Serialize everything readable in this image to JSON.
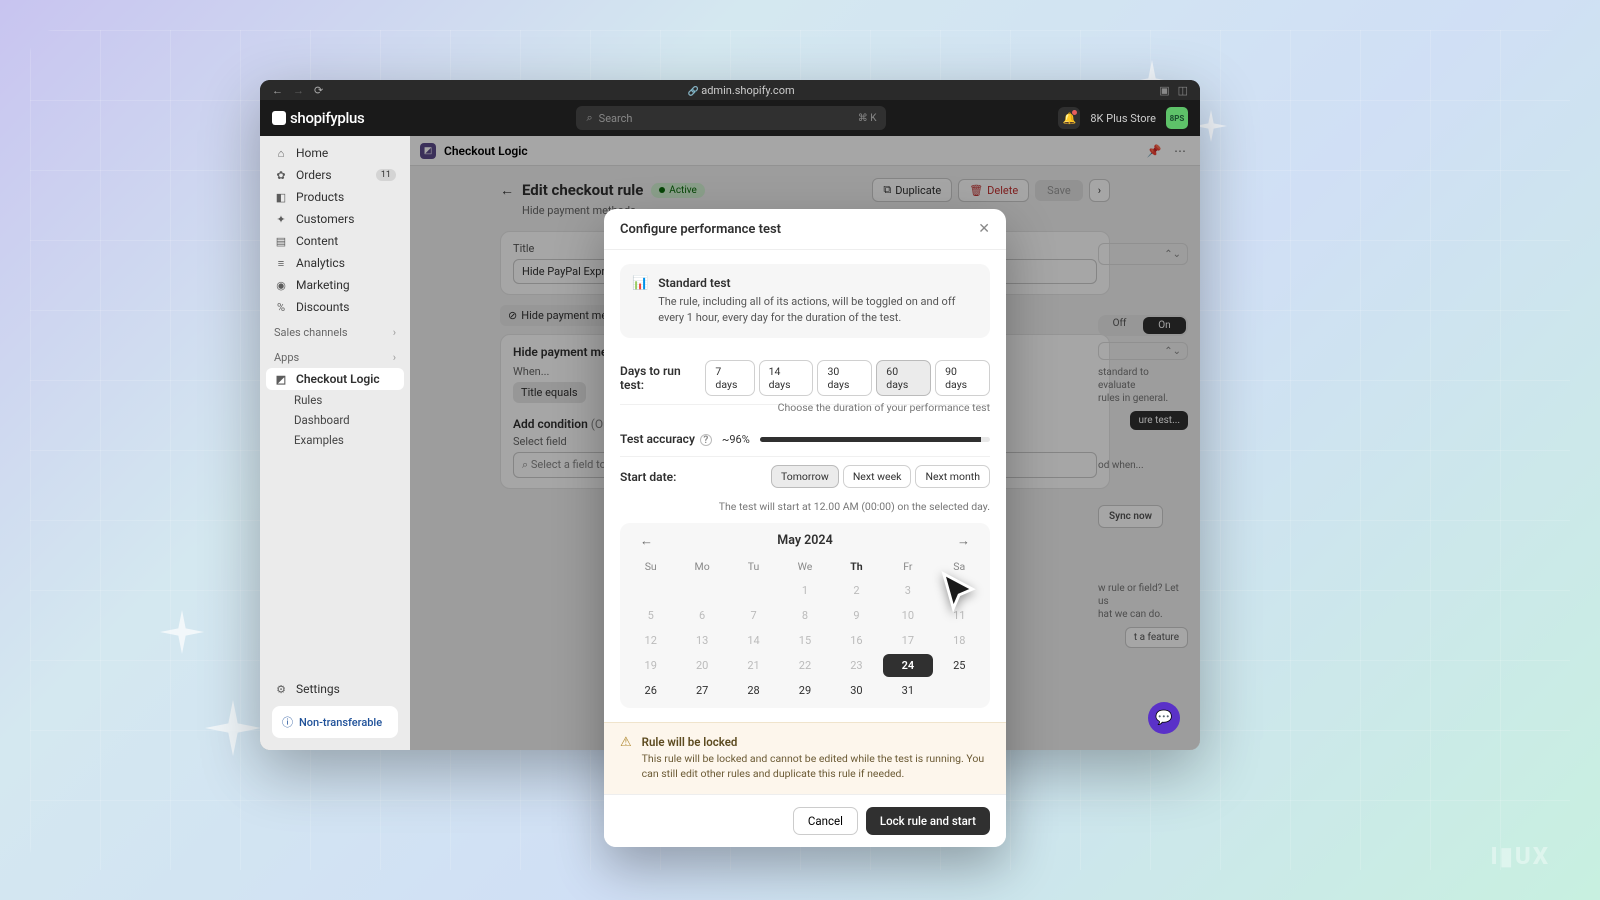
{
  "browser": {
    "url": "admin.shopify.com"
  },
  "topbar": {
    "logo": "shopifyplus",
    "search_placeholder": "Search",
    "search_kbd": "⌘ K",
    "store_name": "8K Plus Store",
    "avatar_initials": "8PS"
  },
  "sidebar": {
    "items": [
      {
        "icon": "⌂",
        "label": "Home"
      },
      {
        "icon": "✿",
        "label": "Orders",
        "badge": "11"
      },
      {
        "icon": "◧",
        "label": "Products"
      },
      {
        "icon": "✦",
        "label": "Customers"
      },
      {
        "icon": "▤",
        "label": "Content"
      },
      {
        "icon": "≡",
        "label": "Analytics"
      },
      {
        "icon": "◉",
        "label": "Marketing"
      },
      {
        "icon": "%",
        "label": "Discounts"
      }
    ],
    "section_channels": "Sales channels",
    "section_apps": "Apps",
    "app": {
      "label": "Checkout Logic",
      "subs": [
        "Rules",
        "Dashboard",
        "Examples"
      ]
    },
    "settings": "Settings",
    "non_transferable": "Non-transferable"
  },
  "page": {
    "app_name": "Checkout Logic",
    "title": "Edit checkout rule",
    "status": "Active",
    "subtitle": "Hide payment methods",
    "actions": {
      "duplicate": "Duplicate",
      "delete": "Delete",
      "save": "Save"
    },
    "card_title_label": "Title",
    "title_value": "Hide PayPal Express C",
    "chip": "Hide payment method",
    "section_hide": "Hide payment method",
    "when": "When...",
    "title_equals": "Title equals",
    "add_condition": "Add condition",
    "optional": "(Optional",
    "select_field": "Select field",
    "select_placeholder": "Select a field to ad",
    "side_off": "Off",
    "side_on": "On",
    "side_hint1": "standard to evaluate",
    "side_hint2": "rules in general.",
    "configure_btn": "ure test...",
    "side_hint3": "od when...",
    "sync": "Sync now",
    "side_hint4": "w rule or field? Let us",
    "side_hint5": "hat we can do.",
    "feature_btn": "t a feature"
  },
  "modal": {
    "title": "Configure performance test",
    "standard_title": "Standard test",
    "standard_desc": "The rule, including all of its actions, will be toggled on and off every 1 hour, every day for the duration of the test.",
    "days_label": "Days to run test:",
    "days_options": [
      "7 days",
      "14 days",
      "30 days",
      "60 days",
      "90 days"
    ],
    "days_selected": "60 days",
    "days_help": "Choose the duration of your performance test",
    "accuracy_label": "Test accuracy",
    "accuracy_value": "~96%",
    "accuracy_pct": 96,
    "start_label": "Start date:",
    "start_options": [
      "Tomorrow",
      "Next week",
      "Next month"
    ],
    "start_selected": "Tomorrow",
    "start_help": "The test will start at 12.00 AM (00:00) on the selected day.",
    "calendar": {
      "month": "May 2024",
      "dow": [
        "Su",
        "Mo",
        "Tu",
        "We",
        "Th",
        "Fr",
        "Sa"
      ],
      "dow_today_index": 4,
      "weeks": [
        [
          "",
          "",
          "",
          "1",
          "2",
          "3",
          "4"
        ],
        [
          "5",
          "6",
          "7",
          "8",
          "9",
          "10",
          "11"
        ],
        [
          "12",
          "13",
          "14",
          "15",
          "16",
          "17",
          "18"
        ],
        [
          "19",
          "20",
          "21",
          "22",
          "23",
          "24",
          "25"
        ],
        [
          "26",
          "27",
          "28",
          "29",
          "30",
          "31",
          ""
        ]
      ],
      "selected_day": "24",
      "enabled_from_row": 3,
      "enabled_from_col": 5
    },
    "warn_title": "Rule will be locked",
    "warn_desc": "This rule will be locked and cannot be edited while the test is running. You can still edit other rules and duplicate this rule if needed.",
    "cancel": "Cancel",
    "confirm": "Lock rule and start"
  }
}
